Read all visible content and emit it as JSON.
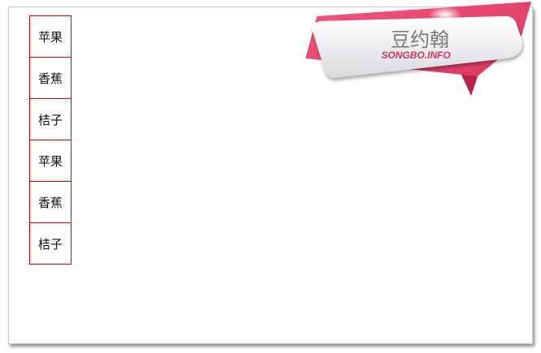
{
  "list": {
    "items": [
      {
        "label": "苹果"
      },
      {
        "label": "香蕉"
      },
      {
        "label": "桔子"
      },
      {
        "label": "苹果"
      },
      {
        "label": "香蕉"
      },
      {
        "label": "桔子"
      }
    ]
  },
  "logo": {
    "title": "豆约翰",
    "subtitle": "SONGBO.INFO",
    "colors": {
      "ribbon": "#e8446a",
      "ribbon_dark": "#c32a52",
      "card": "#f3f3f5",
      "title": "#7a7a7a",
      "subtitle": "#d8345e"
    }
  }
}
